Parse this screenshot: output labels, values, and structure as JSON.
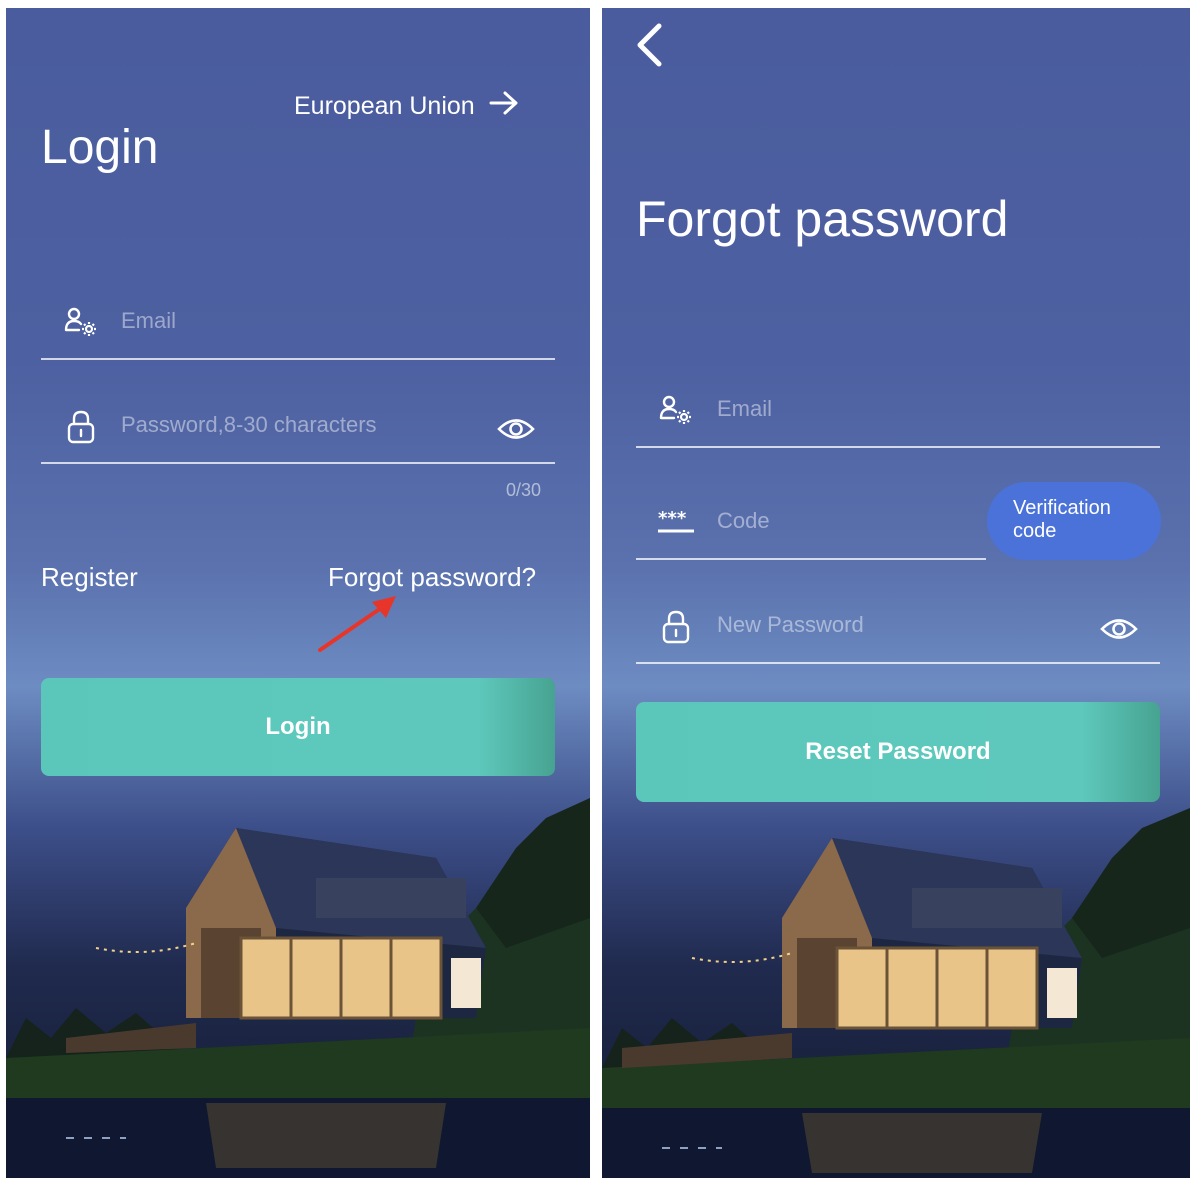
{
  "login": {
    "region_label": "European Union",
    "region_arrow": "arrow-right-icon",
    "title": "Login",
    "email_placeholder": "Email",
    "password_placeholder": "Password,8-30 characters",
    "char_count": "0/30",
    "register_link": "Register",
    "forgot_link": "Forgot password?",
    "login_button": "Login",
    "annotation": "red-arrow-pointer"
  },
  "forgot": {
    "back_icon": "chevron-left-icon",
    "title": "Forgot password",
    "email_placeholder": "Email",
    "code_placeholder": "Code",
    "verification_button": "Verification code",
    "new_password_placeholder": "New Password",
    "reset_button": "Reset Password"
  },
  "colors": {
    "accent_teal": "#5ec8bc",
    "verification_blue": "#4a72d8",
    "annotation_red": "#e8352a"
  }
}
